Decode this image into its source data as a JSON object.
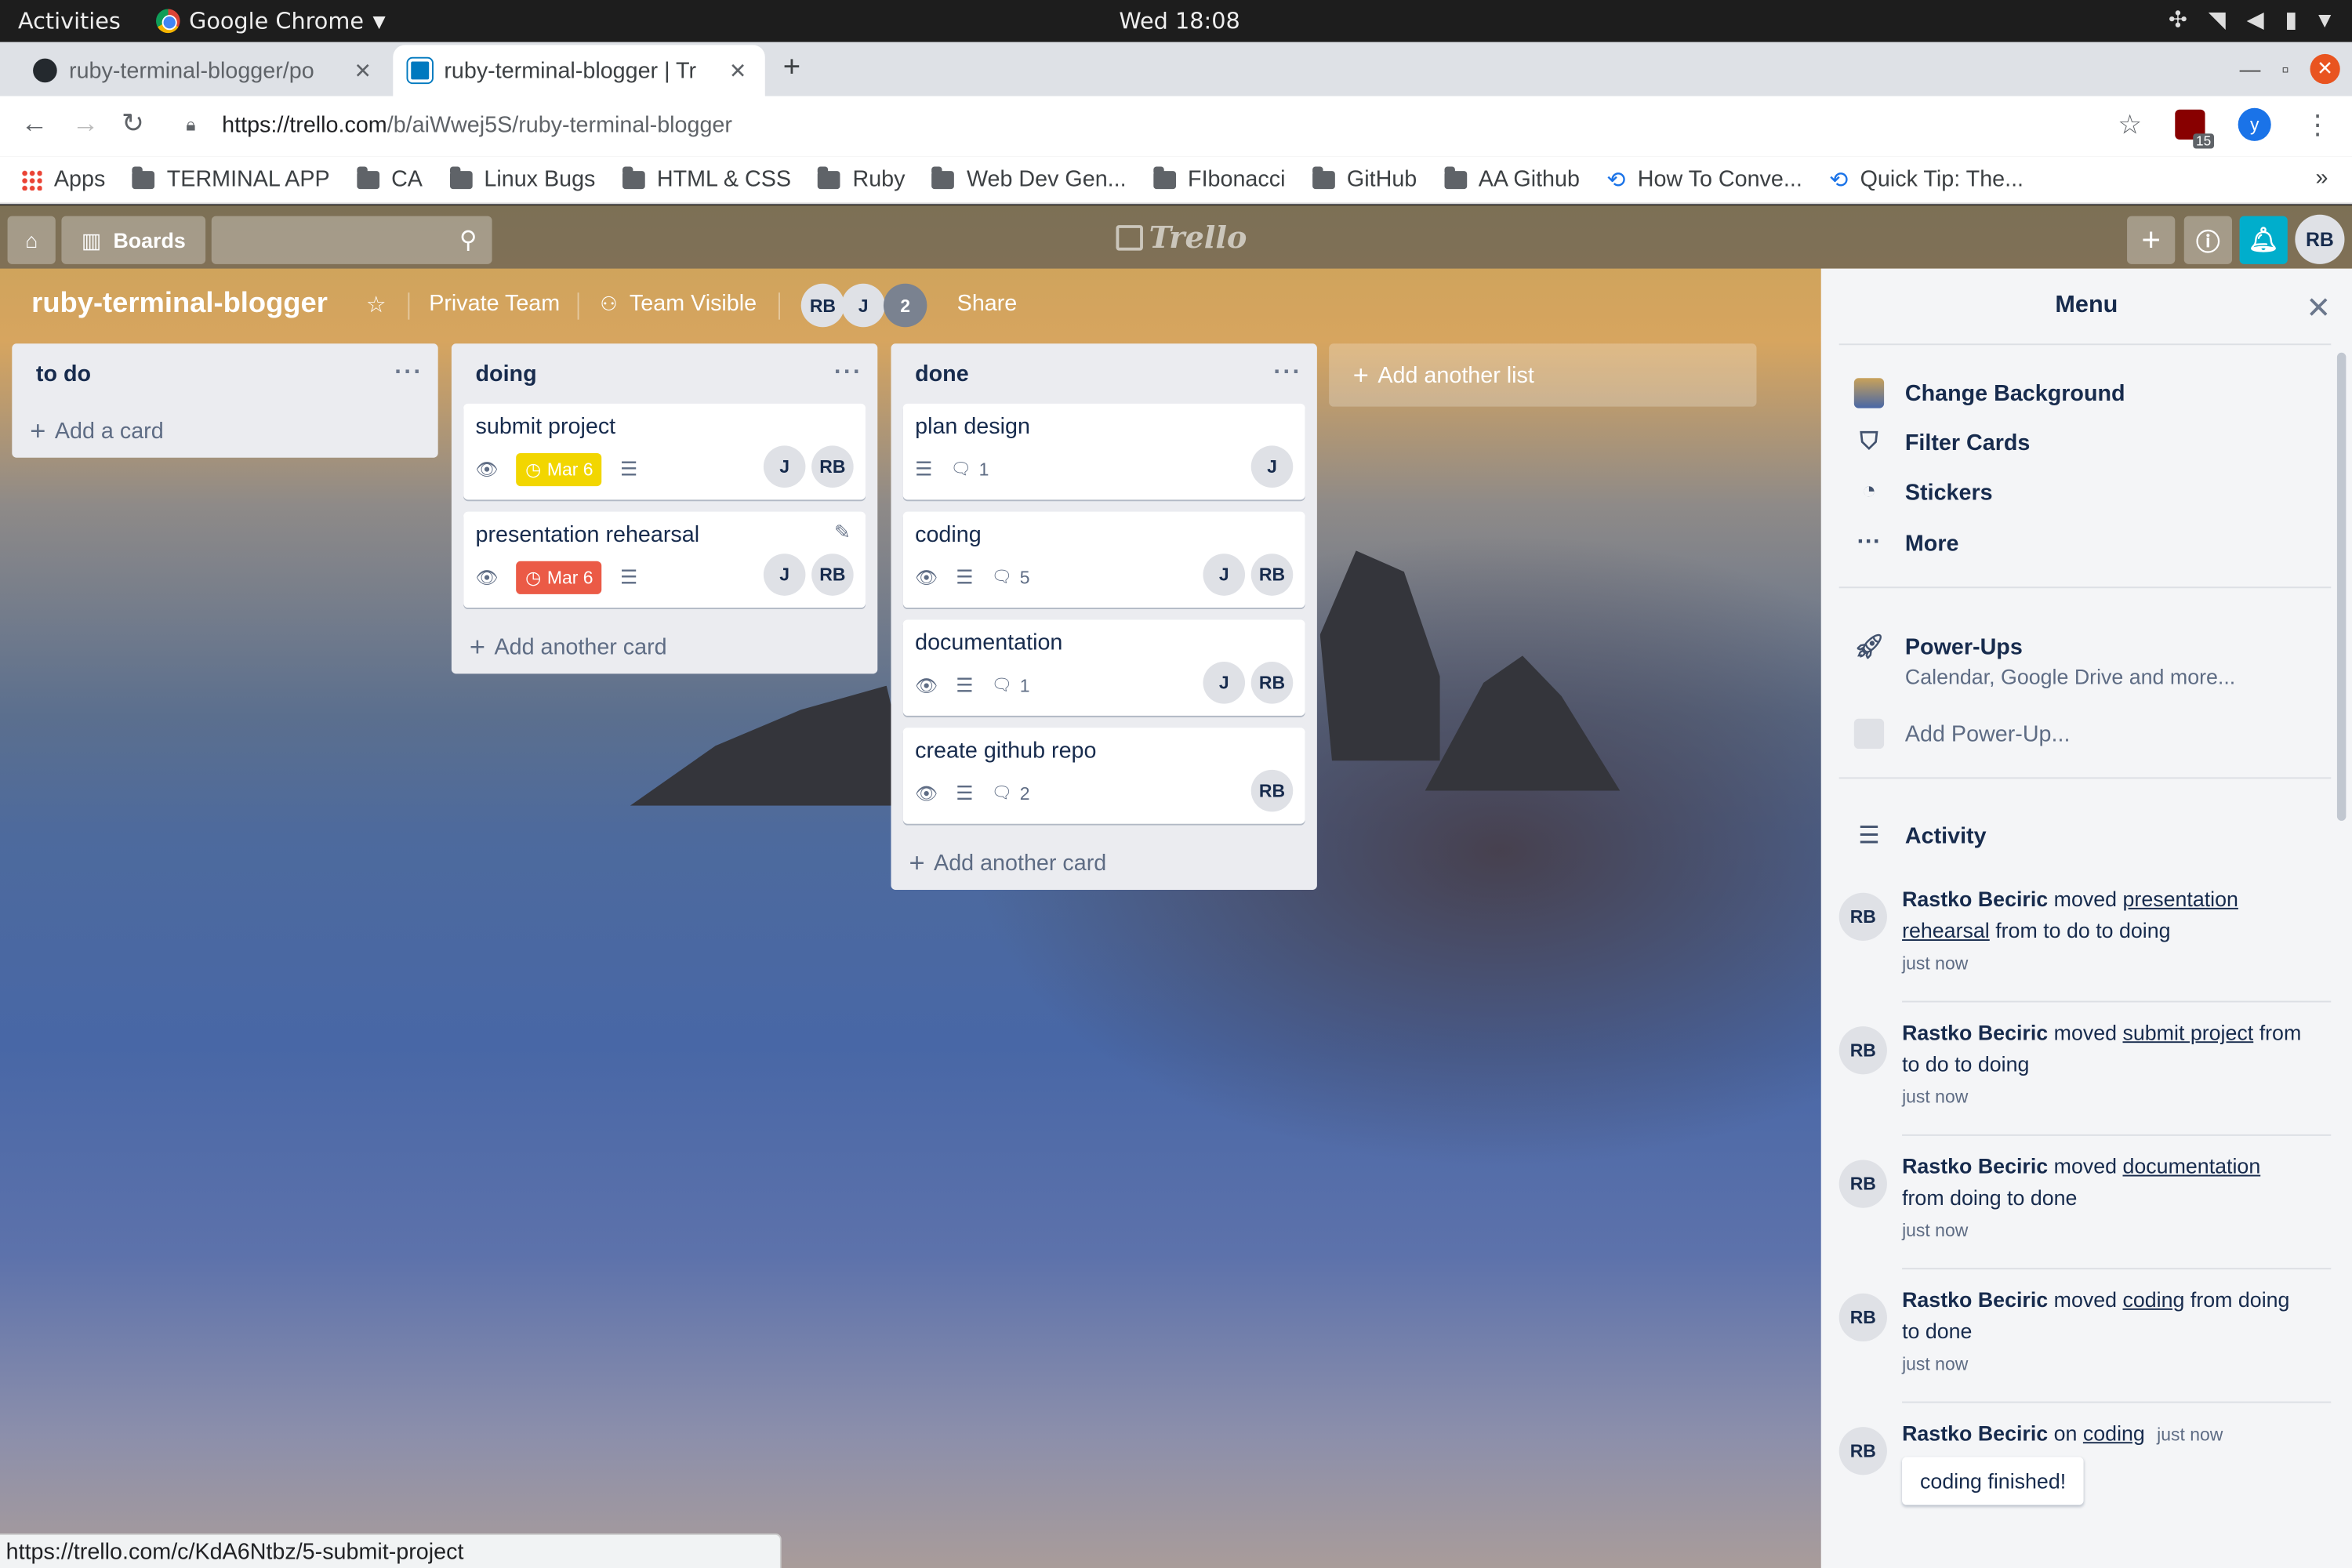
{
  "os_bar": {
    "activities": "Activities",
    "app_name": "Google Chrome",
    "clock": "Wed 18:08"
  },
  "browser": {
    "tabs": [
      {
        "title": "ruby-terminal-blogger/po",
        "icon": "github-icon"
      },
      {
        "title": "ruby-terminal-blogger | Tr",
        "icon": "trello-icon"
      }
    ],
    "url_host": "https://trello.com",
    "url_path": "/b/aiWwej5S/ruby-terminal-blogger",
    "profile_initial": "y",
    "extension_count": "15",
    "status_url": "https://trello.com/c/KdA6Ntbz/5-submit-project"
  },
  "bookmarks": [
    {
      "label": "Apps",
      "icon": "apps-icon"
    },
    {
      "label": "TERMINAL APP",
      "icon": "folder-icon"
    },
    {
      "label": "CA",
      "icon": "folder-icon"
    },
    {
      "label": "Linux Bugs",
      "icon": "folder-icon"
    },
    {
      "label": "HTML & CSS",
      "icon": "folder-icon"
    },
    {
      "label": "Ruby",
      "icon": "folder-icon"
    },
    {
      "label": "Web Dev Gen...",
      "icon": "folder-icon"
    },
    {
      "label": "FIbonacci",
      "icon": "folder-icon"
    },
    {
      "label": "GitHub",
      "icon": "folder-icon"
    },
    {
      "label": "AA Github",
      "icon": "folder-icon"
    },
    {
      "label": "How To Conve...",
      "icon": "link-icon"
    },
    {
      "label": "Quick Tip: The...",
      "icon": "link-icon"
    }
  ],
  "trello_header": {
    "boards_label": "Boards",
    "search_value": "",
    "logo_text": "Trello",
    "user_initials": "RB"
  },
  "board": {
    "title": "ruby-terminal-blogger",
    "team": "Private Team",
    "visibility": "Team Visible",
    "members": [
      "RB",
      "J"
    ],
    "extra_member_count": "2",
    "share_label": "Share",
    "add_list_label": "Add another list",
    "lists": [
      {
        "name": "to do",
        "add_label": "Add a card",
        "cards": []
      },
      {
        "name": "doing",
        "add_label": "Add another card",
        "cards": [
          {
            "title": "submit project",
            "watch": true,
            "due": "Mar 6",
            "due_color": "#f2d600",
            "description": true,
            "comments": "",
            "members": [
              "J",
              "RB"
            ]
          },
          {
            "title": "presentation rehearsal",
            "watch": true,
            "due": "Mar 6",
            "due_color": "#eb5a46",
            "description": true,
            "comments": "",
            "members": [
              "J",
              "RB"
            ]
          }
        ]
      },
      {
        "name": "done",
        "add_label": "Add another card",
        "cards": [
          {
            "title": "plan design",
            "watch": false,
            "due": "",
            "description": true,
            "comments": "1",
            "members": [
              "J"
            ]
          },
          {
            "title": "coding",
            "watch": true,
            "due": "",
            "description": true,
            "comments": "5",
            "members": [
              "J",
              "RB"
            ]
          },
          {
            "title": "documentation",
            "watch": true,
            "due": "",
            "description": true,
            "comments": "1",
            "members": [
              "J",
              "RB"
            ]
          },
          {
            "title": "create github repo",
            "watch": true,
            "due": "",
            "description": true,
            "comments": "2",
            "members": [
              "RB"
            ]
          }
        ]
      }
    ]
  },
  "menu": {
    "title": "Menu",
    "items": [
      {
        "label": "Change Background",
        "icon": "background-thumbnail-icon"
      },
      {
        "label": "Filter Cards",
        "icon": "filter-icon"
      },
      {
        "label": "Stickers",
        "icon": "sticker-icon"
      },
      {
        "label": "More",
        "icon": "more-icon"
      }
    ],
    "powerups_title": "Power-Ups",
    "powerups_sub": "Calendar, Google Drive and more...",
    "add_powerup": "Add Power-Up...",
    "activity_title": "Activity",
    "activity": [
      {
        "user": "Rastko Beciric",
        "verb": "moved",
        "link": "presentation rehearsal",
        "rest": "from to do to doing",
        "time": "just now"
      },
      {
        "user": "Rastko Beciric",
        "verb": "moved",
        "link": "submit project",
        "rest": "from to do to doing",
        "time": "just now"
      },
      {
        "user": "Rastko Beciric",
        "verb": "moved",
        "link": "documentation",
        "rest": "from doing to done",
        "time": "just now"
      },
      {
        "user": "Rastko Beciric",
        "verb": "moved",
        "link": "coding",
        "rest": "from doing to done",
        "time": "just now"
      },
      {
        "user": "Rastko Beciric",
        "verb": "on",
        "link": "coding",
        "rest": "",
        "time": "just now",
        "comment": "coding finished!"
      }
    ]
  },
  "colors": {
    "due_yellow": "#f2d600",
    "due_red": "#eb5a46",
    "notification_blue": "#00aecc",
    "gnome_close": "#e95420"
  }
}
